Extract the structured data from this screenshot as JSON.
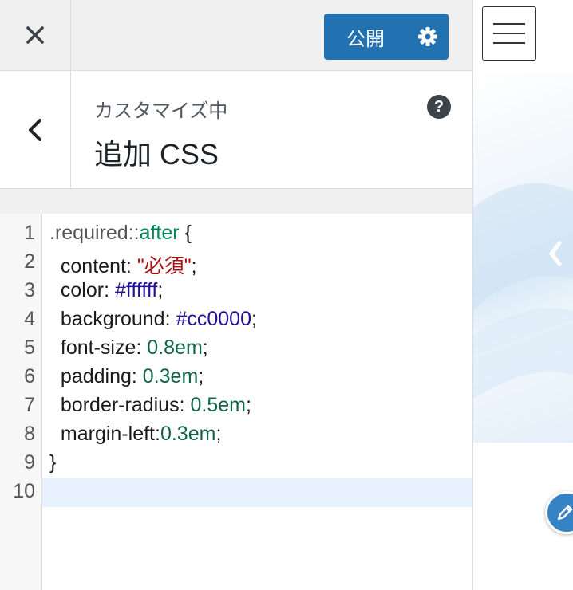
{
  "header": {
    "close_icon": "close-icon",
    "publish_label": "公開",
    "settings_icon": "gear-icon"
  },
  "section": {
    "customizing_label": "カスタマイズ中",
    "title": "追加 CSS",
    "help_label": "?"
  },
  "editor": {
    "line_numbers": [
      "1",
      "2",
      "3",
      "4",
      "5",
      "6",
      "7",
      "8",
      "9",
      "10"
    ],
    "lines": [
      {
        "selector": ".required",
        "sep": "::",
        "pseudo": "after",
        "brace": " {"
      },
      {
        "prop": "content",
        "colon": ": ",
        "value": "\"必須\"",
        "semi": ";"
      },
      {
        "prop": "color",
        "colon": ": ",
        "value": "#ffffff",
        "semi": ";"
      },
      {
        "prop": "background",
        "colon": ": ",
        "value": "#cc0000",
        "semi": ";"
      },
      {
        "prop": "font-size",
        "colon": ": ",
        "value": "0.8em",
        "semi": ";"
      },
      {
        "prop": "padding",
        "colon": ": ",
        "value": "0.3em",
        "semi": ";"
      },
      {
        "prop": "border-radius",
        "colon": ": ",
        "value": "0.5em",
        "semi": ";"
      },
      {
        "prop": "margin-left",
        "colon": ":",
        "value": "0.3em",
        "semi": ";"
      },
      {
        "close": "}"
      },
      {
        "empty": ""
      }
    ]
  },
  "preview": {
    "menu_icon": "hamburger-icon",
    "edit_icon": "pencil-icon"
  },
  "colors": {
    "accent": "#2271b1",
    "string": "#aa1111",
    "atom": "#221199",
    "number": "#116644"
  }
}
